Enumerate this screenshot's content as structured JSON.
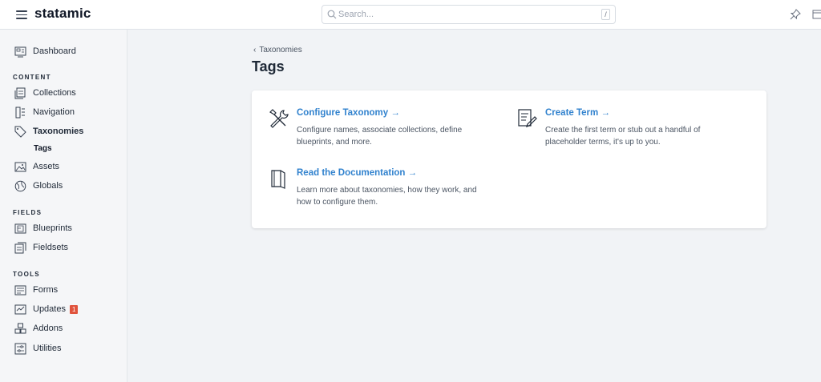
{
  "brand": "statamic",
  "search": {
    "placeholder": "Search...",
    "shortcut": "/"
  },
  "sidebar": {
    "dashboard": "Dashboard",
    "sections": {
      "content": "CONTENT",
      "fields": "FIELDS",
      "tools": "TOOLS"
    },
    "content_items": [
      "Collections",
      "Navigation",
      "Taxonomies"
    ],
    "sub_item": "Tags",
    "content_items_2": [
      "Assets",
      "Globals"
    ],
    "fields_items": [
      "Blueprints",
      "Fieldsets"
    ],
    "tools_items": [
      "Forms",
      "Updates",
      "Addons",
      "Utilities"
    ],
    "updates_badge": "1"
  },
  "breadcrumb": {
    "chevron": "‹",
    "label": "Taxonomies"
  },
  "page_title": "Tags",
  "tiles": {
    "configure": {
      "title": "Configure Taxonomy →",
      "desc": "Configure names, associate collections, define blueprints, and more."
    },
    "create": {
      "title": "Create Term →",
      "desc": "Create the first term or stub out a handful of placeholder terms, it's up to you."
    },
    "docs": {
      "title": "Read the Documentation →",
      "desc": "Learn more about taxonomies, how they work, and how to configure them."
    }
  },
  "colors": {
    "accent": "#3182ce",
    "badge": "#e0533d",
    "background": "#f1f3f6"
  },
  "icons": [
    "hamburger-icon",
    "search-icon",
    "pin-icon",
    "site-icon",
    "dashboard-icon",
    "collections-icon",
    "navigation-icon",
    "tag-icon",
    "assets-icon",
    "globals-icon",
    "blueprints-icon",
    "fieldsets-icon",
    "forms-icon",
    "updates-icon",
    "addons-icon",
    "utilities-icon",
    "tools-icon",
    "term-icon",
    "book-icon"
  ]
}
